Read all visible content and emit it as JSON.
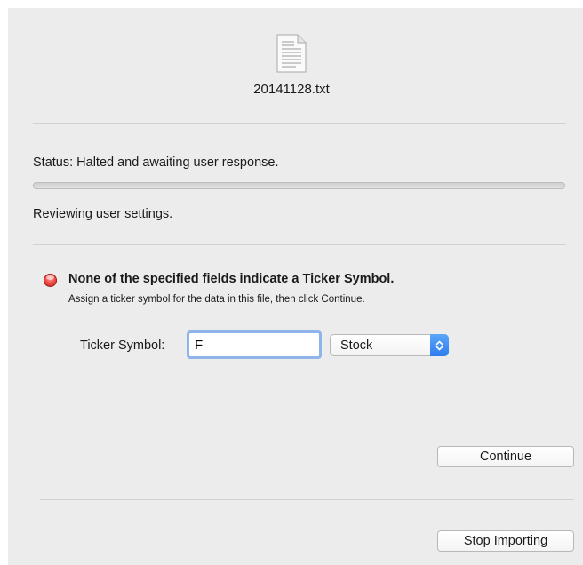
{
  "file": {
    "name": "20141128.txt",
    "icon": "text-document-icon"
  },
  "status": {
    "text": "Status:  Halted and awaiting user response.",
    "progress_percent": 0
  },
  "activity": {
    "text": "Reviewing user settings."
  },
  "alert": {
    "icon": "red-stop-icon",
    "title": "None of the specified fields indicate a Ticker Symbol.",
    "message": "Assign a ticker symbol for the data in this file, then click Continue."
  },
  "ticker": {
    "label": "Ticker Symbol:",
    "value": "F",
    "type_selected": "Stock"
  },
  "buttons": {
    "continue": "Continue",
    "stop_importing": "Stop Importing"
  },
  "colors": {
    "panel_background": "#ececec",
    "focus_ring": "#8fb4ec",
    "select_accent": "#2e7df0",
    "alert_red": "#ef4a43"
  }
}
